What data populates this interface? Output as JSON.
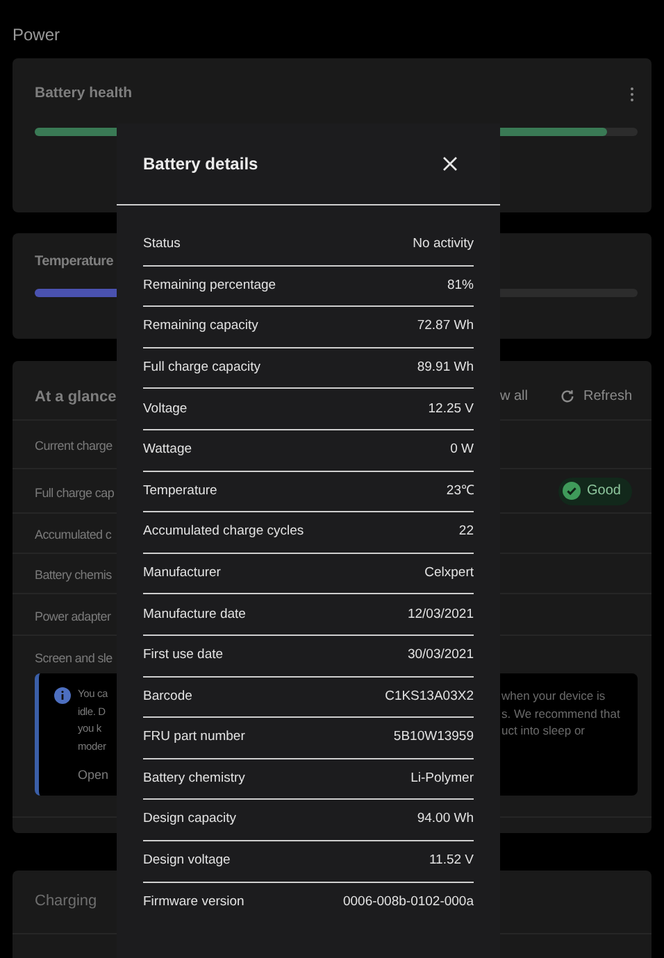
{
  "page_title": "Power",
  "battery_health": {
    "title": "Battery health",
    "level": 0.95
  },
  "temperature": {
    "title": "Temperature",
    "level": 0.3
  },
  "at_a_glance": {
    "title": "At a glance",
    "view_all": "w all",
    "refresh": "Refresh",
    "rows": [
      {
        "label": "Current charge"
      },
      {
        "label": "Full charge cap",
        "badge": "Good"
      },
      {
        "label": "Accumulated c"
      },
      {
        "label": "Battery chemis"
      },
      {
        "label": "Power adapter"
      },
      {
        "label": "Screen and sle"
      }
    ],
    "info": {
      "left_lines": [
        "You ca",
        "idle. D",
        "you k",
        "moder"
      ],
      "right_lines": [
        "when your device is",
        "s. We recommend that",
        "uct into sleep or"
      ],
      "link": "Open"
    }
  },
  "charging": {
    "title": "Charging"
  },
  "dialog": {
    "title": "Battery details",
    "rows": [
      {
        "label": "Status",
        "value": "No activity"
      },
      {
        "label": "Remaining percentage",
        "value": "81%"
      },
      {
        "label": "Remaining capacity",
        "value": "72.87 Wh"
      },
      {
        "label": "Full charge capacity",
        "value": "89.91 Wh"
      },
      {
        "label": "Voltage",
        "value": "12.25 V"
      },
      {
        "label": "Wattage",
        "value": "0 W"
      },
      {
        "label": "Temperature",
        "value": "23℃"
      },
      {
        "label": "Accumulated charge cycles",
        "value": "22"
      },
      {
        "label": "Manufacturer",
        "value": "Celxpert"
      },
      {
        "label": "Manufacture date",
        "value": "12/03/2021"
      },
      {
        "label": "First use date",
        "value": "30/03/2021"
      },
      {
        "label": "Barcode",
        "value": "C1KS13A03X2"
      },
      {
        "label": "FRU part number",
        "value": "5B10W13959"
      },
      {
        "label": "Battery chemistry",
        "value": "Li-Polymer"
      },
      {
        "label": "Design capacity",
        "value": "94.00 Wh"
      },
      {
        "label": "Design voltage",
        "value": "11.52 V"
      },
      {
        "label": "Firmware version",
        "value": "0006-008b-0102-000a"
      }
    ]
  }
}
